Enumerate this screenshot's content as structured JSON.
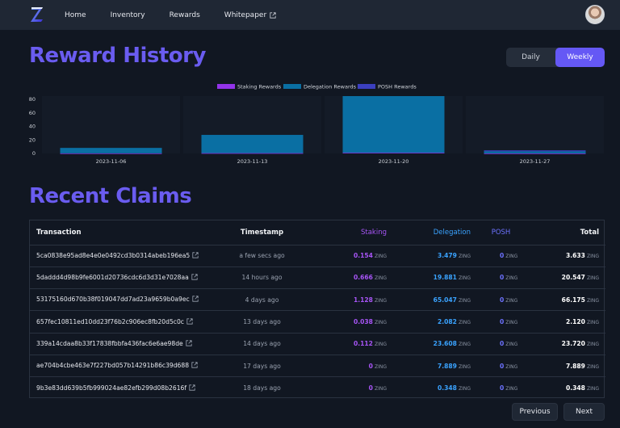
{
  "nav": {
    "logo_icon": "zing-logo-icon",
    "links": [
      {
        "label": "Home"
      },
      {
        "label": "Inventory"
      },
      {
        "label": "Rewards"
      },
      {
        "label": "Whitepaper",
        "external": true
      }
    ],
    "avatar_icon": "user-avatar"
  },
  "reward_history": {
    "title": "Reward History",
    "toggle": {
      "daily": "Daily",
      "weekly": "Weekly",
      "selected": "Weekly"
    }
  },
  "chart_data": {
    "type": "bar",
    "categories": [
      "2023-11-06",
      "2023-11-13",
      "2023-11-20",
      "2023-11-27"
    ],
    "series": [
      {
        "name": "Staking Rewards",
        "color": "#9333ea",
        "values": [
          0.2,
          0.5,
          1.0,
          0.1
        ]
      },
      {
        "name": "Delegation Rewards",
        "color": "#0a6fa3",
        "values": [
          8,
          27,
          84,
          3
        ]
      },
      {
        "name": "POSH Rewards",
        "color": "#3b3fbf",
        "values": [
          0,
          0,
          0,
          1.5
        ]
      }
    ],
    "stacked": true,
    "ylim": [
      0,
      85
    ],
    "yticks": [
      "80",
      "60",
      "40",
      "20",
      "0"
    ],
    "legend_position": "top-center",
    "grid": false
  },
  "recent_claims": {
    "title": "Recent Claims",
    "columns": {
      "transaction": "Transaction",
      "timestamp": "Timestamp",
      "staking": "Staking",
      "delegation": "Delegation",
      "posh": "POSH",
      "total": "Total"
    },
    "unit": "ZING",
    "rows": [
      {
        "tx": "5ca0838e95ad8e4e0e0492cd3b0314abeb196ea5",
        "time": "a few secs ago",
        "staking": "0.154",
        "delegation": "3.479",
        "posh": "0",
        "total": "3.633"
      },
      {
        "tx": "5daddd4d98b9fe6001d20736cdc6d3d31e7028aa",
        "time": "14 hours ago",
        "staking": "0.666",
        "delegation": "19.881",
        "posh": "0",
        "total": "20.547"
      },
      {
        "tx": "53175160d670b38f019047dd7ad23a9659b0a9ec",
        "time": "4 days ago",
        "staking": "1.128",
        "delegation": "65.047",
        "posh": "0",
        "total": "66.175"
      },
      {
        "tx": "657fec10811ed10dd23f76b2c906ec8fb20d5c0c",
        "time": "13 days ago",
        "staking": "0.038",
        "delegation": "2.082",
        "posh": "0",
        "total": "2.120"
      },
      {
        "tx": "339a14cdaa8b33f17838fbbfa436fac6e6ae98de",
        "time": "14 days ago",
        "staking": "0.112",
        "delegation": "23.608",
        "posh": "0",
        "total": "23.720"
      },
      {
        "tx": "ae704b4cbe463e7f227bd057b14291b86c39d688",
        "time": "17 days ago",
        "staking": "0",
        "delegation": "7.889",
        "posh": "0",
        "total": "7.889"
      },
      {
        "tx": "9b3e83dd639b5fb999024ae82efb299d08b2616f",
        "time": "18 days ago",
        "staking": "0",
        "delegation": "0.348",
        "posh": "0",
        "total": "0.348"
      }
    ]
  },
  "pagination": {
    "previous": "Previous",
    "next": "Next"
  },
  "colors": {
    "accent": "#6558f5",
    "staking": "#a855f7",
    "delegation": "#3aa3ff",
    "posh": "#6d72ff"
  }
}
